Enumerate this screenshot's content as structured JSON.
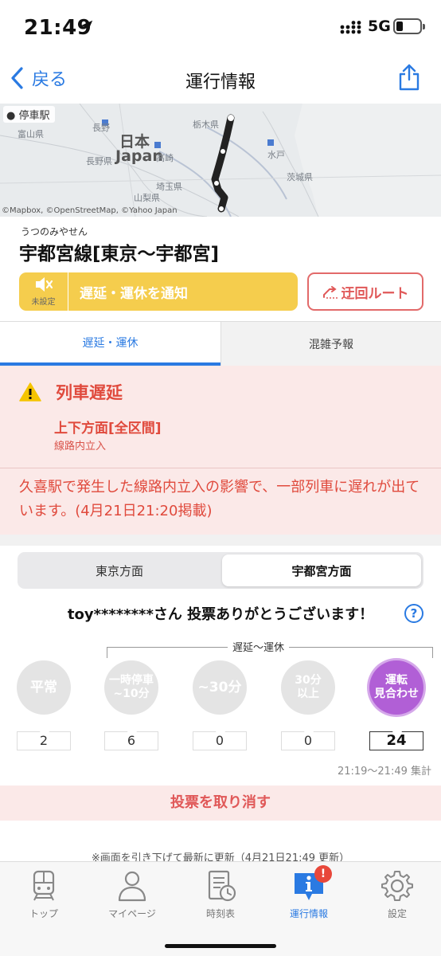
{
  "status_bar": {
    "time": "21:49",
    "network": "5G"
  },
  "nav": {
    "back_label": "戻る",
    "title": "運行情報",
    "share_icon": "share-icon"
  },
  "map": {
    "badge": "停車駅",
    "credit": "©Mapbox, ©OpenStreetMap, ©Yahoo Japan",
    "labels": {
      "japan_jp": "日本",
      "japan_en": "Japan",
      "tochigi": "栃木県",
      "ibaraki": "茨城県",
      "nagano": "長野",
      "toyama": "富山県",
      "saitama": "埼玉県",
      "yamanashi": "山梨県",
      "mito": "水戸",
      "takasaki": "高崎",
      "nagano_pref": "長野県"
    }
  },
  "line": {
    "ruby": "うつのみやせん",
    "name": "宇都宮線[東京〜宇都宮]"
  },
  "actions": {
    "mute_label": "未設定",
    "notify_label": "遅延・運休を通知",
    "detour_label": "迂回ルート"
  },
  "tabs": {
    "delay": "遅延・運休",
    "congestion": "混雑予報"
  },
  "alert": {
    "title": "列車遅延",
    "section": "上下方面[全区間]",
    "cause": "線路内立入",
    "message": "久喜駅で発生した線路内立入の影響で、一部列車に遅れが出ています。(4月21日21:20掲載)"
  },
  "direction": {
    "left": "東京方面",
    "right": "宇都宮方面",
    "selected": "宇都宮方面"
  },
  "vote": {
    "thanks": "toy********さん 投票ありがとうございます！",
    "help": "?",
    "bracket_label": "遅延〜運休",
    "options": [
      {
        "l1": "平常",
        "l2": "",
        "count": "2",
        "selected": false
      },
      {
        "l1": "一時停車",
        "l2": "~10分",
        "count": "6",
        "selected": false
      },
      {
        "l1": "~30分",
        "l2": "",
        "count": "0",
        "selected": false
      },
      {
        "l1": "30分",
        "l2": "以上",
        "count": "0",
        "selected": false
      },
      {
        "l1": "運転",
        "l2": "見合わせ",
        "count": "24",
        "selected": true
      }
    ],
    "tally": "21:19〜21:49 集計",
    "cancel": "投票を取り消す"
  },
  "refresh_note": "※画面を引き下げて最新に更新（4月21日21:49 更新）",
  "tabbar": {
    "items": [
      {
        "label": "トップ",
        "icon": "train-icon"
      },
      {
        "label": "マイページ",
        "icon": "person-icon"
      },
      {
        "label": "時刻表",
        "icon": "timetable-icon"
      },
      {
        "label": "運行情報",
        "icon": "info-icon"
      },
      {
        "label": "設定",
        "icon": "gear-icon"
      }
    ],
    "badge": "!"
  },
  "colors": {
    "accent": "#2a7ae2",
    "alert": "#e04a3d",
    "notify": "#f5cd4d",
    "vote_selected": "#b15fd6"
  }
}
